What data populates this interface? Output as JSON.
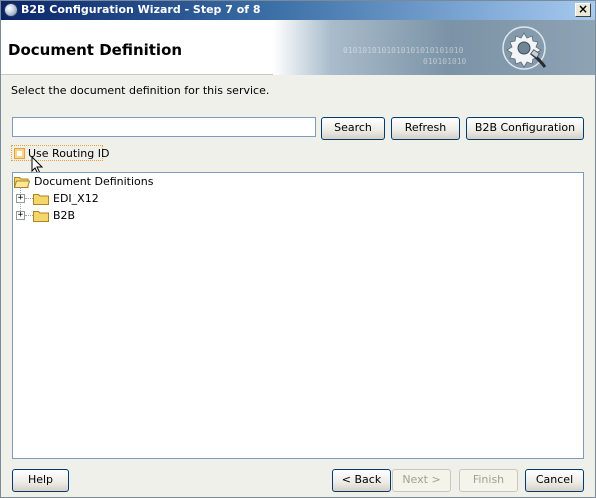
{
  "window": {
    "title": "B2B Configuration Wizard - Step 7 of 8",
    "close_label": "×"
  },
  "header": {
    "title": "Document Definition",
    "banner_binary": [
      "0101010101010101010101010",
      "010101010"
    ],
    "icon": "gear-connector-icon"
  },
  "instruction": "Select the document definition for this service.",
  "search": {
    "value": "",
    "placeholder": "",
    "search_label": "Search",
    "refresh_label": "Refresh",
    "b2b_config_label": "B2B Configuration"
  },
  "routing": {
    "checkbox_label": "Use Routing ID",
    "checked": false
  },
  "tree": {
    "root": {
      "label": "Document Definitions",
      "icon": "folder-open-icon"
    },
    "children": [
      {
        "label": "EDI_X12",
        "icon": "folder-icon",
        "expander": "+"
      },
      {
        "label": "B2B",
        "icon": "folder-icon",
        "expander": "+"
      }
    ]
  },
  "footer": {
    "help_label": "Help",
    "back_label": "< Back",
    "next_label": "Next >",
    "finish_label": "Finish",
    "cancel_label": "Cancel"
  },
  "colors": {
    "titlebar_start": "#0a246a",
    "titlebar_end": "#a6caf0",
    "focus_accent": "#e8a23a",
    "disabled_text": "#a1a192"
  }
}
